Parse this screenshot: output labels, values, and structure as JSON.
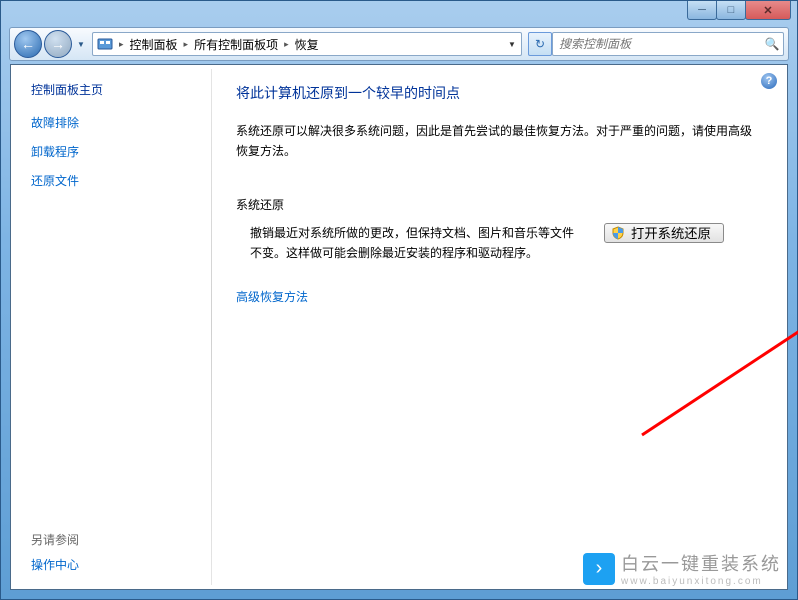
{
  "titlebar": {
    "minimize_glyph": "─",
    "maximize_glyph": "□",
    "close_glyph": "✕"
  },
  "toolbar": {
    "back_glyph": "←",
    "fwd_glyph": "→",
    "drop_glyph": "▼",
    "breadcrumb_sep": "▸",
    "crumb1": "控制面板",
    "crumb2": "所有控制面板项",
    "crumb3": "恢复",
    "refresh_glyph": "↻",
    "search_placeholder": "搜索控制面板",
    "search_glyph": "🔍"
  },
  "sidebar": {
    "title": "控制面板主页",
    "links": [
      "故障排除",
      "卸载程序",
      "还原文件"
    ],
    "see_also_hdr": "另请参阅",
    "see_also_link": "操作中心"
  },
  "main": {
    "help_glyph": "?",
    "heading": "将此计算机还原到一个较早的时间点",
    "description": "系统还原可以解决很多系统问题，因此是首先尝试的最佳恢复方法。对于严重的问题，请使用高级恢复方法。",
    "section_header": "系统还原",
    "section_text": "撤销最近对系统所做的更改，但保持文档、图片和音乐等文件不变。这样做可能会删除最近安装的程序和驱动程序。",
    "open_button": "打开系统还原",
    "advanced_link": "高级恢复方法"
  },
  "watermark": {
    "badge_glyph": "›",
    "text": "白云一键重装系统",
    "sub": "www.baiyunxitong.com"
  }
}
